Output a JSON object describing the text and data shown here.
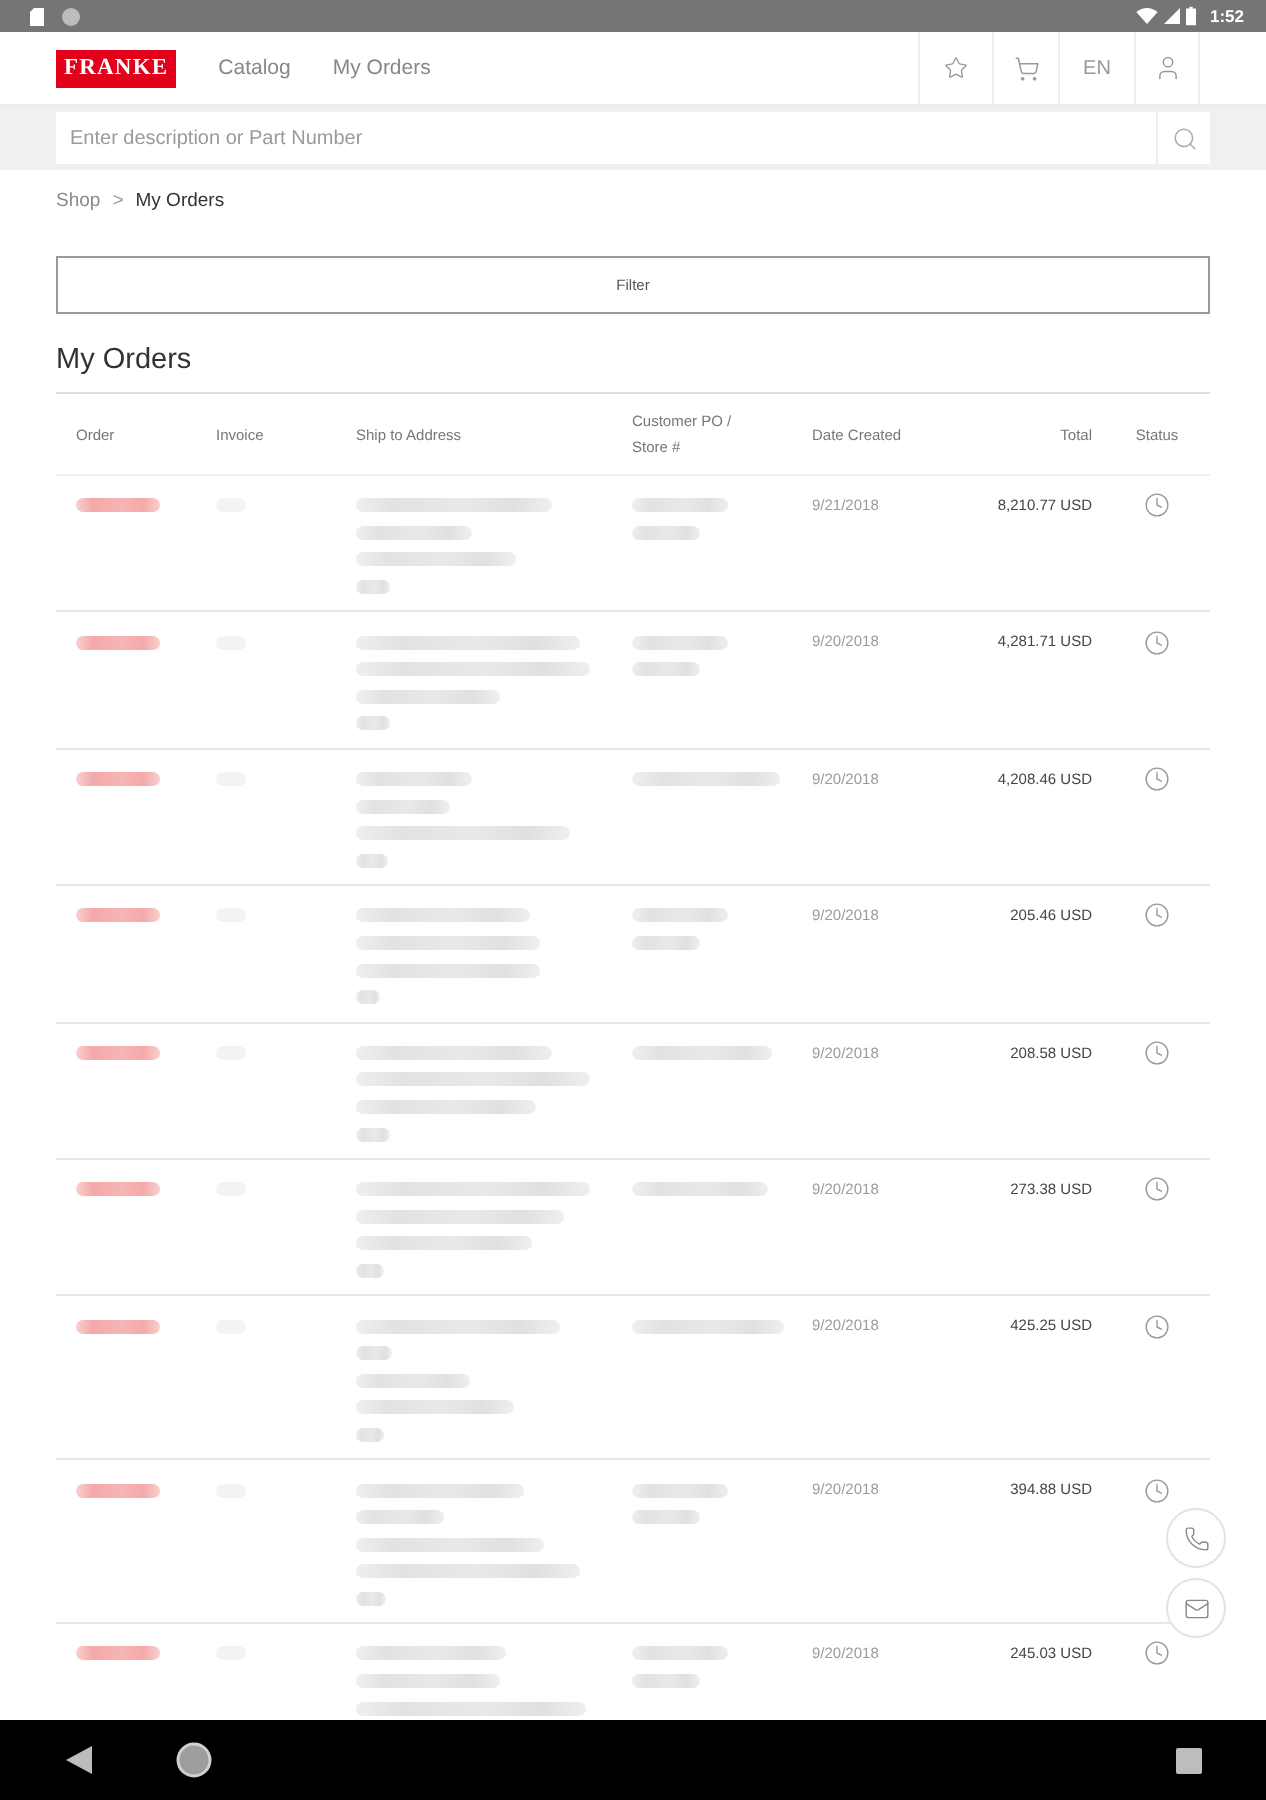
{
  "status_bar": {
    "time": "1:52"
  },
  "header": {
    "logo": "FRANKE",
    "nav": [
      {
        "label": "Catalog",
        "selected": false
      },
      {
        "label": "My Orders",
        "selected": false
      }
    ],
    "language": "EN"
  },
  "search": {
    "placeholder": "Enter description or Part Number"
  },
  "breadcrumb": {
    "separator": ">",
    "items": [
      {
        "label": "Shop",
        "current": false
      },
      {
        "label": "My Orders",
        "current": true
      }
    ]
  },
  "filter_button": "Filter",
  "title": "My Orders",
  "table": {
    "columns": [
      "Order",
      "Invoice",
      "Ship to Address",
      "Customer PO / Store #",
      "Date Created",
      "Total",
      "Status"
    ],
    "rows": [
      {
        "order": {
          "blurred": true
        },
        "invoice": {
          "blurred": true
        },
        "ship_to_address": [
          {
            "blurred": true
          },
          {
            "blurred": true
          },
          {
            "blurred": true
          },
          {
            "blurred": true
          }
        ],
        "customer_po": [
          {
            "blurred": true
          },
          {
            "blurred": true
          }
        ],
        "date_created": "9/21/2018",
        "total": "8,210.77 USD"
      },
      {
        "order": {
          "blurred": true
        },
        "invoice": {
          "blurred": true
        },
        "ship_to_address": [
          {
            "blurred": true
          },
          {
            "blurred": true
          },
          {
            "blurred": true
          },
          {
            "blurred": true
          }
        ],
        "customer_po": [
          {
            "blurred": true
          },
          {
            "blurred": true
          }
        ],
        "date_created": "9/20/2018",
        "total": "4,281.71 USD"
      },
      {
        "order": {
          "blurred": true
        },
        "invoice": {
          "blurred": true
        },
        "ship_to_address": [
          {
            "blurred": true
          },
          {
            "blurred": true
          },
          {
            "blurred": true
          },
          {
            "blurred": true
          }
        ],
        "customer_po": [
          {
            "blurred": true
          }
        ],
        "date_created": "9/20/2018",
        "total": "4,208.46 USD"
      },
      {
        "order": {
          "blurred": true
        },
        "invoice": {
          "blurred": true
        },
        "ship_to_address": [
          {
            "blurred": true
          },
          {
            "blurred": true
          },
          {
            "blurred": true
          },
          {
            "blurred": true
          }
        ],
        "customer_po": [
          {
            "blurred": true
          },
          {
            "blurred": true
          }
        ],
        "date_created": "9/20/2018",
        "total": "205.46 USD"
      },
      {
        "order": {
          "blurred": true
        },
        "invoice": {
          "blurred": true
        },
        "ship_to_address": [
          {
            "blurred": true
          },
          {
            "blurred": true
          },
          {
            "blurred": true
          },
          {
            "blurred": true
          }
        ],
        "customer_po": [
          {
            "blurred": true
          }
        ],
        "date_created": "9/20/2018",
        "total": "208.58 USD"
      },
      {
        "order": {
          "blurred": true
        },
        "invoice": {
          "blurred": true
        },
        "ship_to_address": [
          {
            "blurred": true
          },
          {
            "blurred": true
          },
          {
            "blurred": true
          },
          {
            "blurred": true
          }
        ],
        "customer_po": [
          {
            "blurred": true
          }
        ],
        "date_created": "9/20/2018",
        "total": "273.38 USD"
      },
      {
        "order": {
          "blurred": true
        },
        "invoice": {
          "blurred": true
        },
        "ship_to_address": [
          {
            "blurred": true
          },
          {
            "blurred": true
          },
          {
            "blurred": true
          },
          {
            "blurred": true
          },
          {
            "blurred": true
          }
        ],
        "customer_po": [
          {
            "blurred": true
          }
        ],
        "date_created": "9/20/2018",
        "total": "425.25 USD"
      },
      {
        "order": {
          "blurred": true
        },
        "invoice": {
          "blurred": true
        },
        "ship_to_address": [
          {
            "blurred": true
          },
          {
            "blurred": true
          },
          {
            "blurred": true
          },
          {
            "blurred": true
          },
          {
            "blurred": true
          }
        ],
        "customer_po": [
          {
            "blurred": true
          },
          {
            "blurred": true
          }
        ],
        "date_created": "9/20/2018",
        "total": "394.88 USD"
      },
      {
        "order": {
          "blurred": true
        },
        "invoice": {
          "blurred": true
        },
        "ship_to_address": [
          {
            "blurred": true
          },
          {
            "blurred": true
          },
          {
            "blurred": true
          }
        ],
        "customer_po": [
          {
            "blurred": true
          },
          {
            "blurred": true
          }
        ],
        "date_created": "9/20/2018",
        "total": "245.03 USD"
      }
    ]
  }
}
